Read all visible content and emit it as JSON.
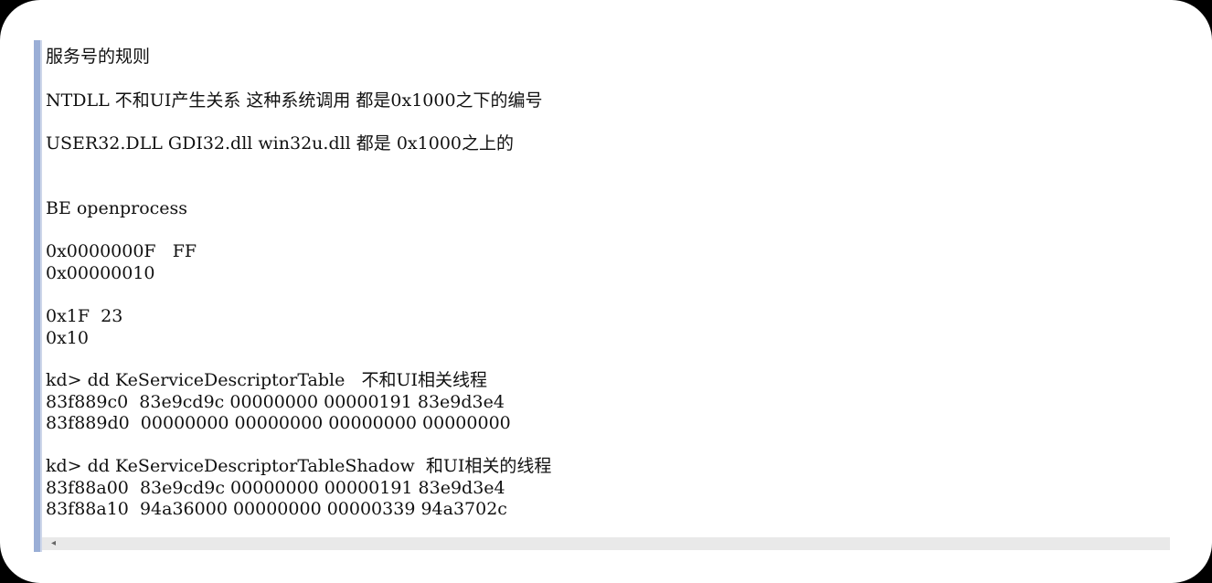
{
  "lines": [
    "服务号的规则",
    "NTDLL 不和UI产生关系 这种系统调用 都是0x1000之下的编号",
    "USER32.DLL GDI32.dll win32u.dll 都是 0x1000之上的",
    "BE openprocess",
    "0x0000000F   FF",
    "0x00000010",
    "0x1F  23",
    "0x10",
    "kd> dd KeServiceDescriptorTable   不和UI相关线程",
    "83f889c0  83e9cd9c 00000000 00000191 83e9d3e4",
    "83f889d0  00000000 00000000 00000000 00000000",
    "kd> dd KeServiceDescriptorTableShadow  和UI相关的线程",
    "83f88a00  83e9cd9c 00000000 00000191 83e9d3e4",
    "83f88a10  94a36000 00000000 00000339 94a3702c"
  ],
  "scrollbar": {
    "left_arrow": "◂"
  }
}
